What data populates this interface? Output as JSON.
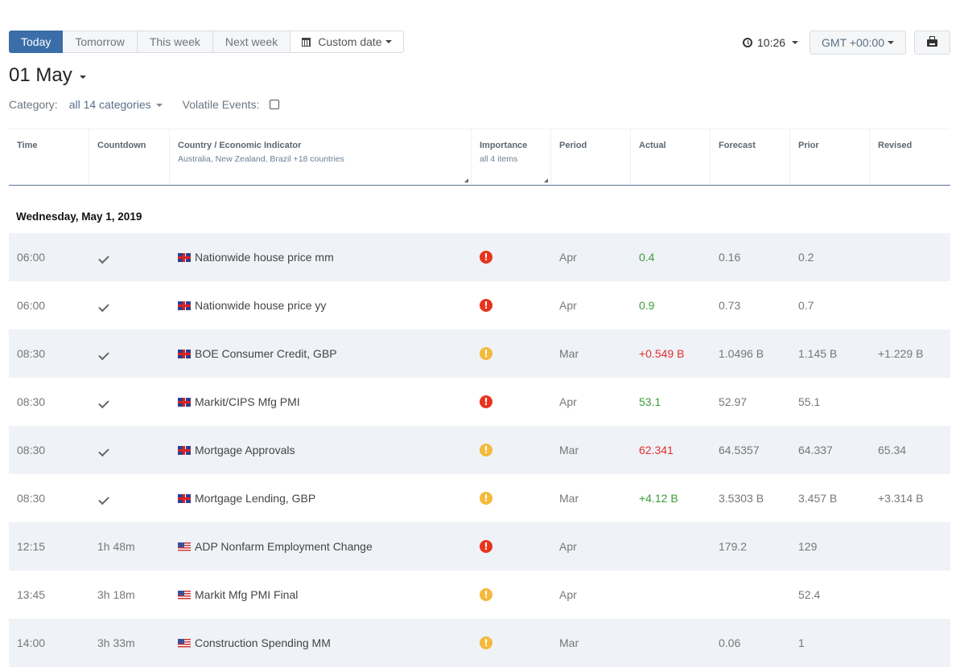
{
  "toolbar": {
    "tabs": [
      {
        "label": "Today",
        "active": true
      },
      {
        "label": "Tomorrow",
        "active": false
      },
      {
        "label": "This week",
        "active": false
      },
      {
        "label": "Next week",
        "active": false
      }
    ],
    "custom_date_label": "Custom date",
    "custom_date_icon": "calendar-icon",
    "time": "10:26",
    "time_icon": "clock-icon",
    "timezone": "GMT +00:00",
    "print_icon": "print-icon"
  },
  "date_title": "01 May",
  "filters": {
    "category_label": "Category:",
    "category_value": "all 14 categories",
    "volatile_label": "Volatile Events:",
    "volatile_checked": false
  },
  "table": {
    "headers": {
      "time": "Time",
      "countdown": "Countdown",
      "indicator": "Country / Economic Indicator",
      "indicator_sub": "Australia, New Zealand, Brazil +18 countries",
      "importance": "Importance",
      "importance_sub": "all 4 items",
      "period": "Period",
      "actual": "Actual",
      "forecast": "Forecast",
      "prior": "Prior",
      "revised": "Revised"
    },
    "day_heading": "Wednesday, May 1, 2019",
    "colors": {
      "positive": "#3a9d3a",
      "negative": "#e03030",
      "high": "#e8341c",
      "medium": "#f5b93b",
      "accent": "#3b6ea8"
    },
    "rows": [
      {
        "time": "06:00",
        "countdown": "",
        "done": true,
        "country": "uk",
        "indicator": "Nationwide house price mm",
        "importance": "high",
        "period": "Apr",
        "actual": "0.4",
        "actual_dir": "pos",
        "forecast": "0.16",
        "prior": "0.2",
        "revised": ""
      },
      {
        "time": "06:00",
        "countdown": "",
        "done": true,
        "country": "uk",
        "indicator": "Nationwide house price yy",
        "importance": "high",
        "period": "Apr",
        "actual": "0.9",
        "actual_dir": "pos",
        "forecast": "0.73",
        "prior": "0.7",
        "revised": ""
      },
      {
        "time": "08:30",
        "countdown": "",
        "done": true,
        "country": "uk",
        "indicator": "BOE Consumer Credit, GBP",
        "importance": "med",
        "period": "Mar",
        "actual": "+0.549 B",
        "actual_dir": "neg",
        "forecast": "1.0496 B",
        "prior": "1.145 B",
        "revised": "+1.229 B"
      },
      {
        "time": "08:30",
        "countdown": "",
        "done": true,
        "country": "uk",
        "indicator": "Markit/CIPS Mfg PMI",
        "importance": "high",
        "period": "Apr",
        "actual": "53.1",
        "actual_dir": "pos",
        "forecast": "52.97",
        "prior": "55.1",
        "revised": ""
      },
      {
        "time": "08:30",
        "countdown": "",
        "done": true,
        "country": "uk",
        "indicator": "Mortgage Approvals",
        "importance": "med",
        "period": "Mar",
        "actual": "62.341",
        "actual_dir": "neg",
        "forecast": "64.5357",
        "prior": "64.337",
        "revised": "65.34"
      },
      {
        "time": "08:30",
        "countdown": "",
        "done": true,
        "country": "uk",
        "indicator": "Mortgage Lending, GBP",
        "importance": "med",
        "period": "Mar",
        "actual": "+4.12 B",
        "actual_dir": "pos",
        "forecast": "3.5303 B",
        "prior": "3.457 B",
        "revised": "+3.314 B"
      },
      {
        "time": "12:15",
        "countdown": "1h 48m",
        "done": false,
        "country": "us",
        "indicator": "ADP Nonfarm Employment Change",
        "importance": "high",
        "period": "Apr",
        "actual": "",
        "actual_dir": "",
        "forecast": "179.2",
        "prior": "129",
        "revised": ""
      },
      {
        "time": "13:45",
        "countdown": "3h 18m",
        "done": false,
        "country": "us",
        "indicator": "Markit Mfg PMI Final",
        "importance": "med",
        "period": "Apr",
        "actual": "",
        "actual_dir": "",
        "forecast": "",
        "prior": "52.4",
        "revised": ""
      },
      {
        "time": "14:00",
        "countdown": "3h 33m",
        "done": false,
        "country": "us",
        "indicator": "Construction Spending MM",
        "importance": "med",
        "period": "Mar",
        "actual": "",
        "actual_dir": "",
        "forecast": "0.06",
        "prior": "1",
        "revised": ""
      }
    ]
  }
}
